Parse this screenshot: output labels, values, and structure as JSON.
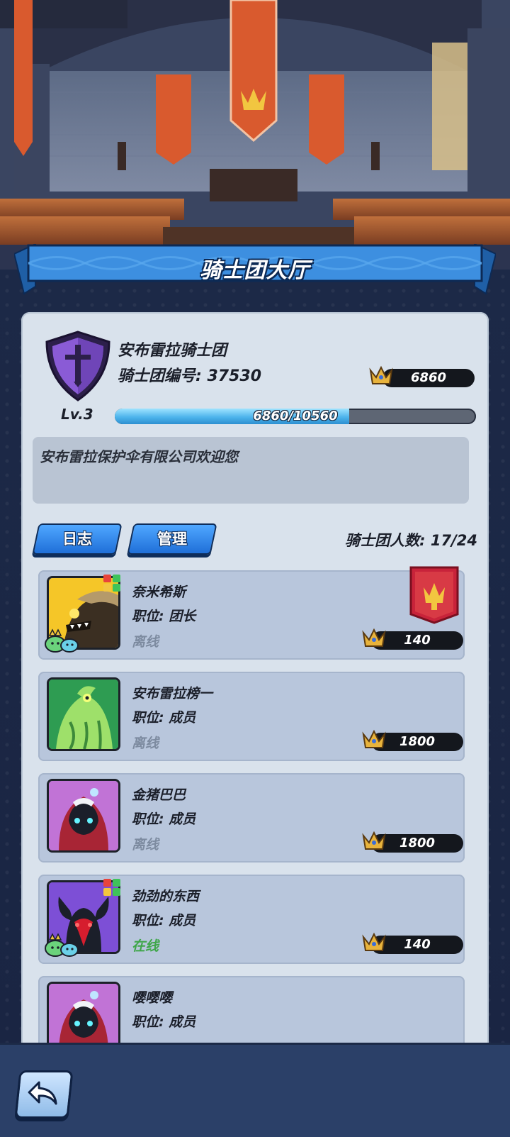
{
  "header": {
    "title": "骑士团大厅"
  },
  "guild": {
    "name": "安布雷拉骑士团",
    "id_text": "骑士团编号: 37530",
    "level_text": "Lv.3",
    "score": "6860",
    "exp_text": "6860/10560",
    "exp_fraction": 0.6496,
    "notice": "安布雷拉保护伞有限公司欢迎您",
    "member_count_text": "骑士团人数: 17/24"
  },
  "buttons": {
    "log_label": "日志",
    "manage_label": "管理"
  },
  "members": [
    {
      "name": "奈米希斯",
      "role": "职位: 团长",
      "status": "离线",
      "score": "140",
      "avatar": "yellow-monster-avatar",
      "leader": true
    },
    {
      "name": "安布雷拉榜一",
      "role": "职位: 成员",
      "status": "离线",
      "score": "1800",
      "avatar": "green-dragon-avatar",
      "leader": false
    },
    {
      "name": "金猪巴巴",
      "role": "职位: 成员",
      "status": "离线",
      "score": "1800",
      "avatar": "hooded-mage-avatar",
      "leader": false
    },
    {
      "name": "劲劲的东西",
      "role": "职位: 成员",
      "status": "在线",
      "score": "140",
      "avatar": "horned-demon-avatar",
      "leader": false
    },
    {
      "name": "嘤嘤嘤",
      "role": "职位: 成员",
      "status": "",
      "score": "",
      "avatar": "hooded-mage-avatar",
      "leader": false
    }
  ],
  "colors": {
    "online": "#3fa64a",
    "offline": "#7d8ba0",
    "accent": "#1f6fd8"
  },
  "icons": {
    "back": "back-arrow-icon",
    "crown": "crown-icon",
    "emblem": "sword-shield-icon"
  }
}
